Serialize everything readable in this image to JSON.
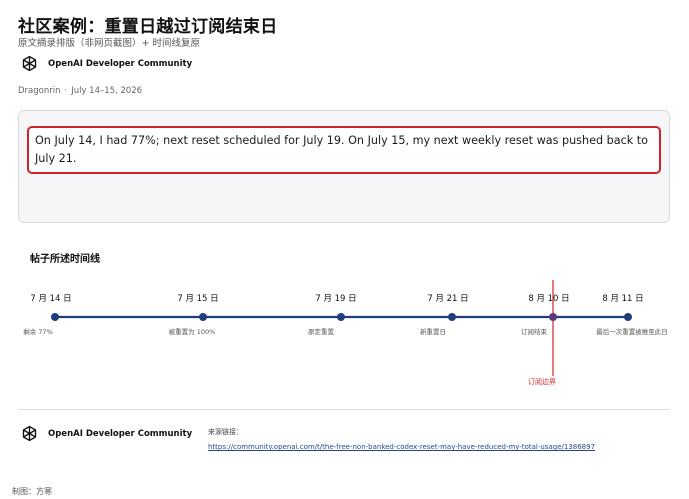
{
  "header": {
    "title": "社区案例：重置日越过订阅结束日",
    "subtitle": "原文摘录排版（非网页截图）+ 时间线复原"
  },
  "brand": {
    "name": "OpenAI Developer Community",
    "icon": "openai-logo-icon"
  },
  "post": {
    "author": "Dragonrin",
    "separator": "·",
    "dates": "July 14–15, 2026",
    "quote": "On July 14, I had 77%; next reset scheduled for July 19. On July 15, my next weekly reset was pushed back to July 21."
  },
  "timeline": {
    "title": "帖子所述时间线",
    "events": [
      {
        "date": "7 月 14 日",
        "caption": "剩余 77%"
      },
      {
        "date": "7 月 15 日",
        "caption": "被重置为 100%"
      },
      {
        "date": "7 月 19 日",
        "caption": "原定重置"
      },
      {
        "date": "7 月 21 日",
        "caption": "新重置日"
      },
      {
        "date": "8 月 10 日",
        "caption": "订阅结束"
      },
      {
        "date": "8 月 11 日",
        "caption": "最后一次重置被推至此日"
      }
    ],
    "boundary_label": "订阅边界",
    "colors": {
      "line": "#1f3f7a",
      "dot": "#1f3f7a",
      "boundary": "#d0212a",
      "highlight_dot": "#5b3a7a"
    }
  },
  "footer": {
    "source_label": "来源链接：",
    "source_url": "https://community.openai.com/t/the-free-non-banked-codex-reset-may-have-reduced-my-total-usage/1386897",
    "credit": "制图：方寒"
  }
}
